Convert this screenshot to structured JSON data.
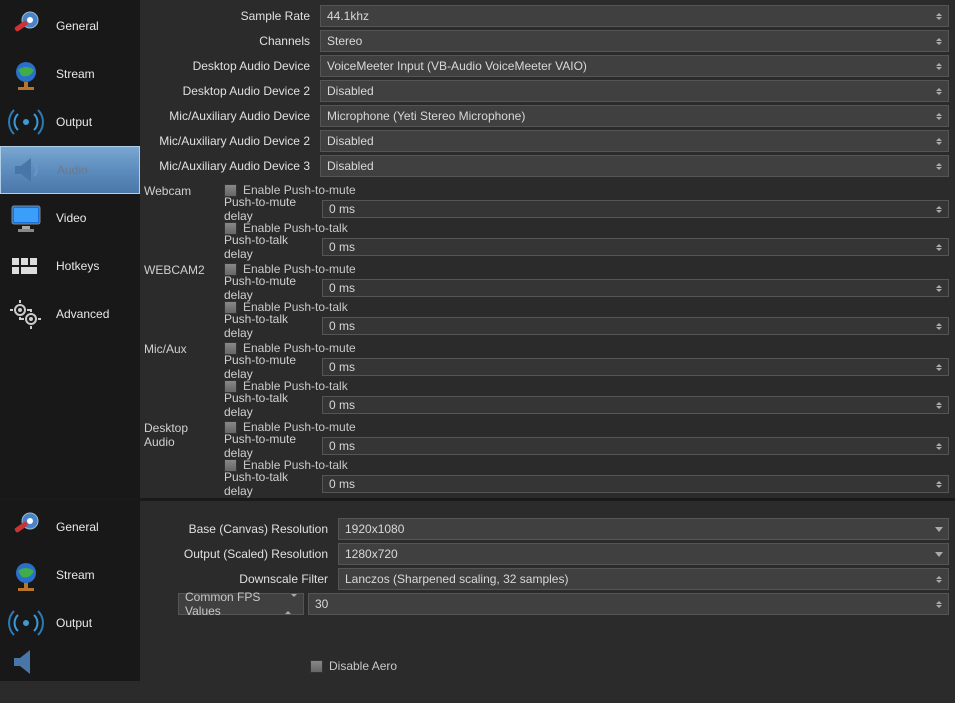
{
  "sidebarTop": {
    "items": [
      {
        "label": "General"
      },
      {
        "label": "Stream"
      },
      {
        "label": "Output"
      },
      {
        "label": "Audio",
        "selected": true
      },
      {
        "label": "Video"
      },
      {
        "label": "Hotkeys"
      },
      {
        "label": "Advanced"
      }
    ]
  },
  "sidebarBottom": {
    "items": [
      {
        "label": "General"
      },
      {
        "label": "Stream"
      },
      {
        "label": "Output"
      }
    ]
  },
  "audio": {
    "rows": [
      {
        "label": "Sample Rate",
        "value": "44.1khz"
      },
      {
        "label": "Channels",
        "value": "Stereo"
      },
      {
        "label": "Desktop Audio Device",
        "value": "VoiceMeeter Input (VB-Audio VoiceMeeter VAIO)"
      },
      {
        "label": "Desktop Audio Device 2",
        "value": "Disabled"
      },
      {
        "label": "Mic/Auxiliary Audio Device",
        "value": "Microphone (Yeti Stereo Microphone)"
      },
      {
        "label": "Mic/Auxiliary Audio Device 2",
        "value": "Disabled"
      },
      {
        "label": "Mic/Auxiliary Audio Device 3",
        "value": "Disabled"
      }
    ],
    "groups": [
      {
        "name": "Webcam"
      },
      {
        "name": "WEBCAM2"
      },
      {
        "name": "Mic/Aux"
      },
      {
        "name": "Desktop Audio"
      }
    ],
    "pushToMuteLabel": "Enable Push-to-mute",
    "pushToMuteDelayLabel": "Push-to-mute delay",
    "pushToTalkLabel": "Enable Push-to-talk",
    "pushToTalkDelayLabel": "Push-to-talk delay",
    "delayValue": "0 ms"
  },
  "video": {
    "baseResLabel": "Base (Canvas) Resolution",
    "baseResValue": "1920x1080",
    "outputResLabel": "Output (Scaled) Resolution",
    "outputResValue": "1280x720",
    "downscaleLabel": "Downscale Filter",
    "downscaleValue": "Lanczos (Sharpened scaling, 32 samples)",
    "fpsTypeLabel": "Common FPS Values",
    "fpsValue": "30",
    "disableAeroLabel": "Disable Aero"
  }
}
